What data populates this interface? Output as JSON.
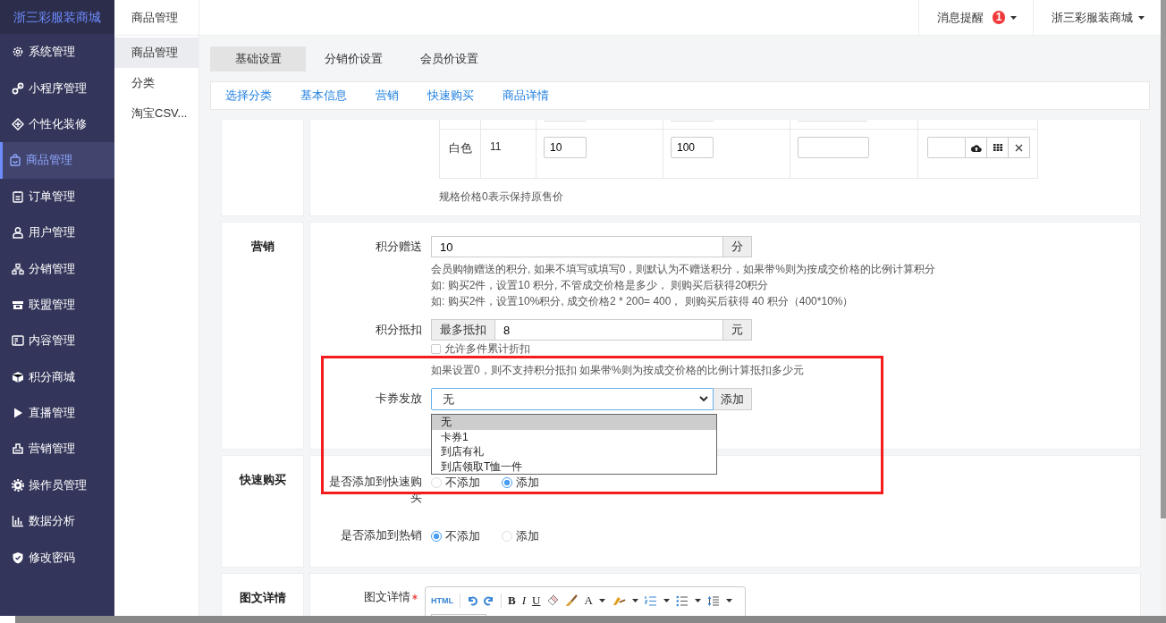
{
  "brand": "浙三彩服装商城",
  "sidebar": {
    "items": [
      {
        "label": "系统管理",
        "selected": false
      },
      {
        "label": "小程序管理",
        "selected": false
      },
      {
        "label": "个性化装修",
        "selected": false
      },
      {
        "label": "商品管理",
        "selected": true
      },
      {
        "label": "订单管理",
        "selected": false
      },
      {
        "label": "用户管理",
        "selected": false
      },
      {
        "label": "分销管理",
        "selected": false
      },
      {
        "label": "联盟管理",
        "selected": false
      },
      {
        "label": "内容管理",
        "selected": false
      },
      {
        "label": "积分商城",
        "selected": false
      },
      {
        "label": "直播管理",
        "selected": false
      },
      {
        "label": "营销管理",
        "selected": false
      },
      {
        "label": "操作员管理",
        "selected": false
      },
      {
        "label": "数据分析",
        "selected": false
      },
      {
        "label": "修改密码",
        "selected": false
      }
    ]
  },
  "subnav": {
    "title": "商品管理",
    "items": [
      {
        "label": "商品管理",
        "selected": true
      },
      {
        "label": "分类",
        "selected": false
      },
      {
        "label": "淘宝CSV...",
        "selected": false
      }
    ]
  },
  "topbar": {
    "notifications": {
      "label": "消息提醒",
      "badge": "1"
    },
    "account": "浙三彩服装商城"
  },
  "tabs": [
    {
      "label": "基础设置",
      "selected": true
    },
    {
      "label": "分销价设置",
      "selected": false
    },
    {
      "label": "会员价设置",
      "selected": false
    }
  ],
  "anchors": [
    "选择分类",
    "基本信息",
    "营销",
    "快速购买",
    "商品详情"
  ],
  "spec_table": {
    "rows": [
      {
        "column_1": "白色",
        "column_2": "11",
        "column_3": "10",
        "column_4": "100"
      }
    ],
    "note": "规格价格0表示保持原售价"
  },
  "marketing": {
    "title": "营销",
    "points_gift": {
      "label": "积分赠送",
      "value": "10",
      "suffix": "分",
      "help": [
        "会员购物赠送的积分, 如果不填写或填写0，则默认为不赠送积分，如果带%则为按成交价格的比例计算积分",
        "如: 购买2件，设置10 积分, 不管成交价格是多少， 则购买后获得20积分",
        "如: 购买2件，设置10%积分, 成交价格2 * 200= 400， 则购买后获得 40 积分（400*10%）"
      ]
    },
    "points_deduct": {
      "label": "积分抵扣",
      "prefix": "最多抵扣",
      "value": "8",
      "suffix": "元",
      "checkbox": {
        "label": "允许多件累计折扣",
        "checked": false
      },
      "help": "如果设置0，则不支持积分抵扣 如果带%则为按成交价格的比例计算抵扣多少元"
    },
    "coupon": {
      "label": "卡券发放",
      "value": "无",
      "button": "添加",
      "options": [
        {
          "label": "无",
          "selected": true
        },
        {
          "label": "卡券1",
          "selected": false
        },
        {
          "label": "到店有礼",
          "selected": false
        },
        {
          "label": "到店领取T恤一件",
          "selected": false
        }
      ]
    }
  },
  "quick_buy": {
    "title": "快速购买",
    "fields": [
      {
        "label": "是否添加到快速购买",
        "options": [
          {
            "label": "不添加",
            "selected": false
          },
          {
            "label": "添加",
            "selected": true
          }
        ]
      },
      {
        "label": "是否添加到热销",
        "options": [
          {
            "label": "不添加",
            "selected": true
          },
          {
            "label": "添加",
            "selected": false
          }
        ]
      }
    ]
  },
  "detail": {
    "title": "图文详情",
    "label": "图文详情",
    "required": true,
    "toolbar": {
      "html": "HTML",
      "bold": "B",
      "italic": "I",
      "underline": "U",
      "font_color": "A"
    }
  }
}
